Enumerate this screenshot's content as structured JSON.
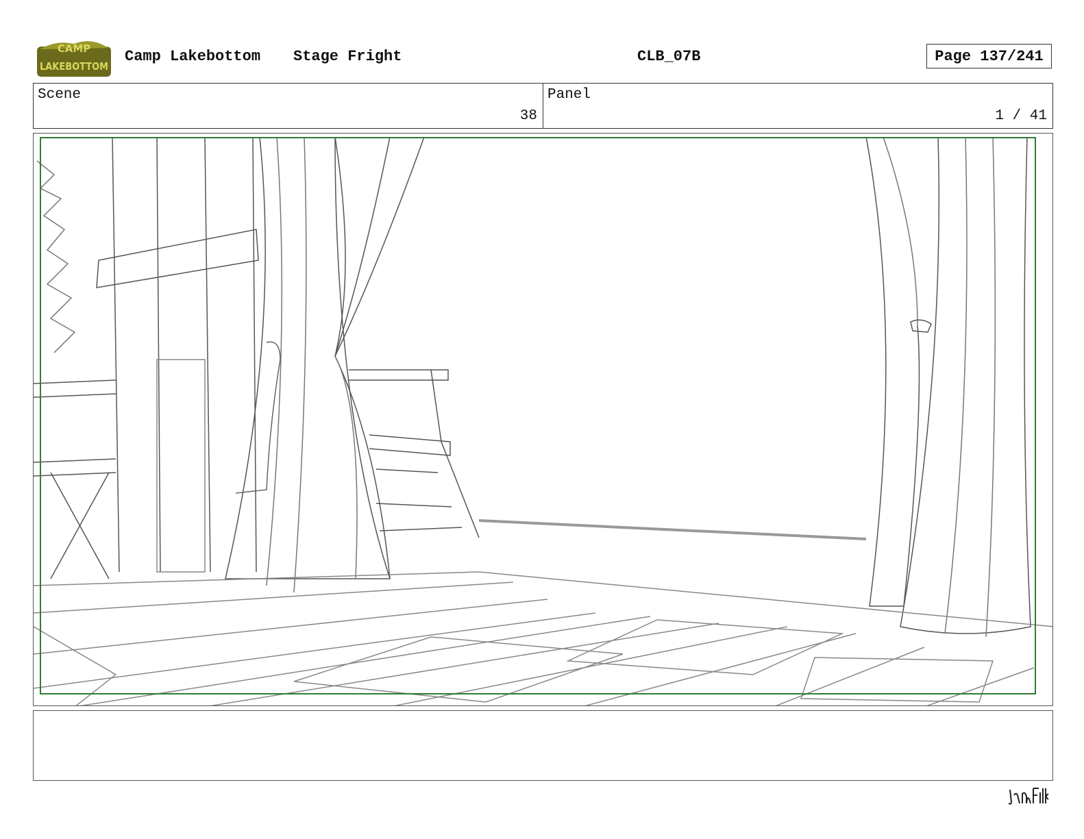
{
  "header": {
    "logo_text": "CAMP LAKEBOTTOM",
    "show_title": "Camp Lakebottom",
    "episode_title": "Stage Fright",
    "production_code": "CLB_07B",
    "page": "Page 137/241"
  },
  "info": {
    "scene_label": "Scene",
    "scene_value": "38",
    "panel_label": "Panel",
    "panel_value": "1 / 41"
  },
  "notes": {
    "text": ""
  },
  "footer": {
    "studio_logo_text": "Jam Filled"
  }
}
